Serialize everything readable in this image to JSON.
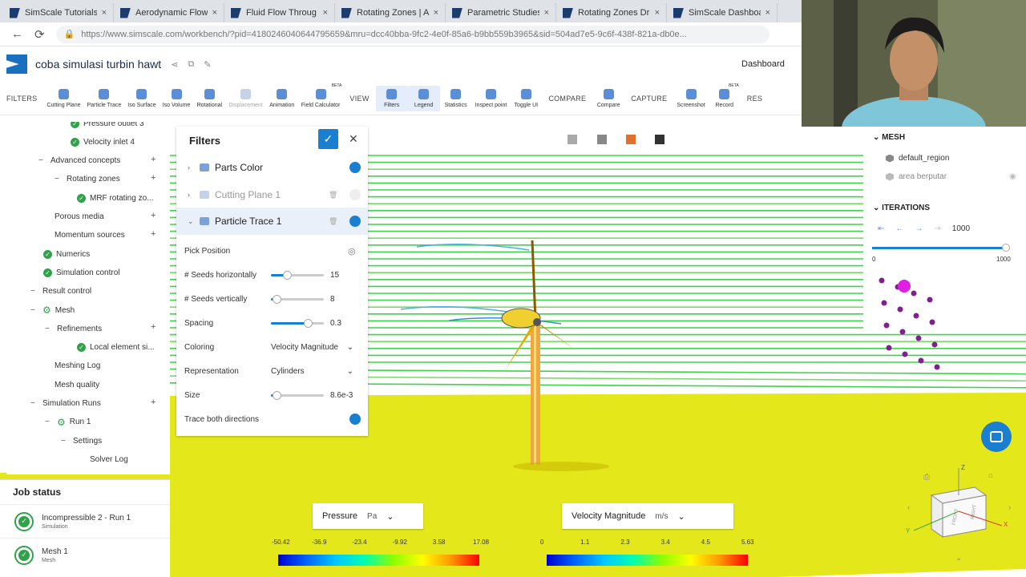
{
  "browser": {
    "tabs": [
      "SimScale Tutorials",
      "Aerodynamic Flow",
      "Fluid Flow Throug",
      "Rotating Zones | A",
      "Parametric Studies",
      "Rotating Zones Dr",
      "SimScale Dashboa"
    ],
    "tab_close": "×",
    "url": "https://www.simscale.com/workbench/?pid=4180246040644795659&mru=dcc40bba-9fc2-4e0f-85a6-b9bb559b3965&sid=504ad7e5-9c6f-438f-821a-db0e..."
  },
  "app": {
    "project_name": "coba simulasi turbin hawt",
    "dashboard_label": "Dashboard"
  },
  "toolbar": {
    "filters_label": "FILTERS",
    "view_label": "VIEW",
    "compare_label": "COMPARE",
    "capture_label": "CAPTURE",
    "res_label": "RES",
    "beta_label": "BETA",
    "buttons": [
      "Cutting Plane",
      "Particle Trace",
      "Iso Surface",
      "Iso Volume",
      "Rotational",
      "Displacement",
      "Animation",
      "Field Calculator",
      "Filters",
      "Legend",
      "Statistics",
      "Inspect point",
      "Toggle UI",
      "Compare",
      "Screenshot",
      "Record"
    ]
  },
  "tree": {
    "items": [
      "Pressure outlet 3",
      "Velocity inlet 4",
      "Advanced concepts",
      "Rotating zones",
      "MRF rotating zo...",
      "Porous media",
      "Momentum sources",
      "Numerics",
      "Simulation control",
      "Result control",
      "Mesh",
      "Refinements",
      "Local element si...",
      "Meshing Log",
      "Mesh quality",
      "Simulation Runs",
      "Run 1",
      "Settings",
      "Solver Log"
    ]
  },
  "job_status": {
    "title": "Job status",
    "jobs": [
      {
        "name": "Incompressible 2 - Run 1",
        "type": "Simulation"
      },
      {
        "name": "Mesh 1",
        "type": "Mesh"
      }
    ]
  },
  "filters_panel": {
    "title": "Filters",
    "rows": [
      "Parts Color",
      "Cutting Plane 1",
      "Particle Trace 1"
    ],
    "props": {
      "pick_position": "Pick Position",
      "seeds_h_label": "# Seeds horizontally",
      "seeds_h_value": "15",
      "seeds_h_level": 0.3,
      "seeds_v_label": "# Seeds vertically",
      "seeds_v_value": "8",
      "seeds_v_level": 0.1,
      "spacing_label": "Spacing",
      "spacing_value": "0.3",
      "spacing_level": 0.7,
      "coloring_label": "Coloring",
      "coloring_value": "Velocity Magnitude",
      "representation_label": "Representation",
      "representation_value": "Cylinders",
      "size_label": "Size",
      "size_value": "8.6e-3",
      "size_level": 0.1,
      "trace_label": "Trace both directions"
    }
  },
  "right_panel": {
    "mesh_title": "MESH",
    "mesh_items": [
      "default_region",
      "area berputar"
    ],
    "iterations_title": "ITERATIONS",
    "iteration_value": "1000",
    "iteration_min": "0",
    "iteration_max": "1000"
  },
  "legend": {
    "pressure": {
      "field": "Pressure",
      "unit": "Pa",
      "ticks": [
        "-50.42",
        "-36.9",
        "-23.4",
        "-9.92",
        "3.58",
        "17.08"
      ]
    },
    "velocity": {
      "field": "Velocity Magnitude",
      "unit": "m/s",
      "ticks": [
        "0",
        "1.1",
        "2.3",
        "3.4",
        "4.5",
        "5.63"
      ]
    }
  },
  "nav_cube": {
    "z_label": "Z",
    "y_label": "Y",
    "x_label": "X",
    "front_label": "FRONT",
    "right_label": "RIGHT"
  }
}
